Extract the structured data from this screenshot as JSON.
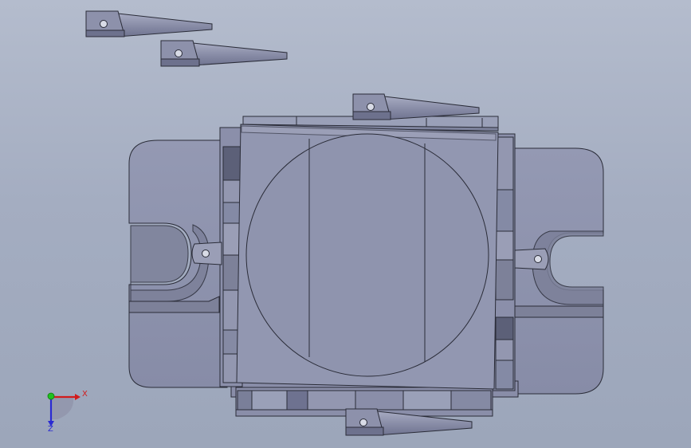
{
  "viewport": {
    "background_top": "#b4bccd",
    "background_bottom": "#9ca6ba",
    "model_fill": "#8f94af",
    "model_edge": "#2a2c38",
    "model_shadow": "#5c6078",
    "model_highlight": "#b8bccf"
  },
  "triad": {
    "x_label": "X",
    "z_label": "Z",
    "x_color": "#d21c1c",
    "y_color": "#1ec21e",
    "z_color": "#2a2ad2"
  }
}
